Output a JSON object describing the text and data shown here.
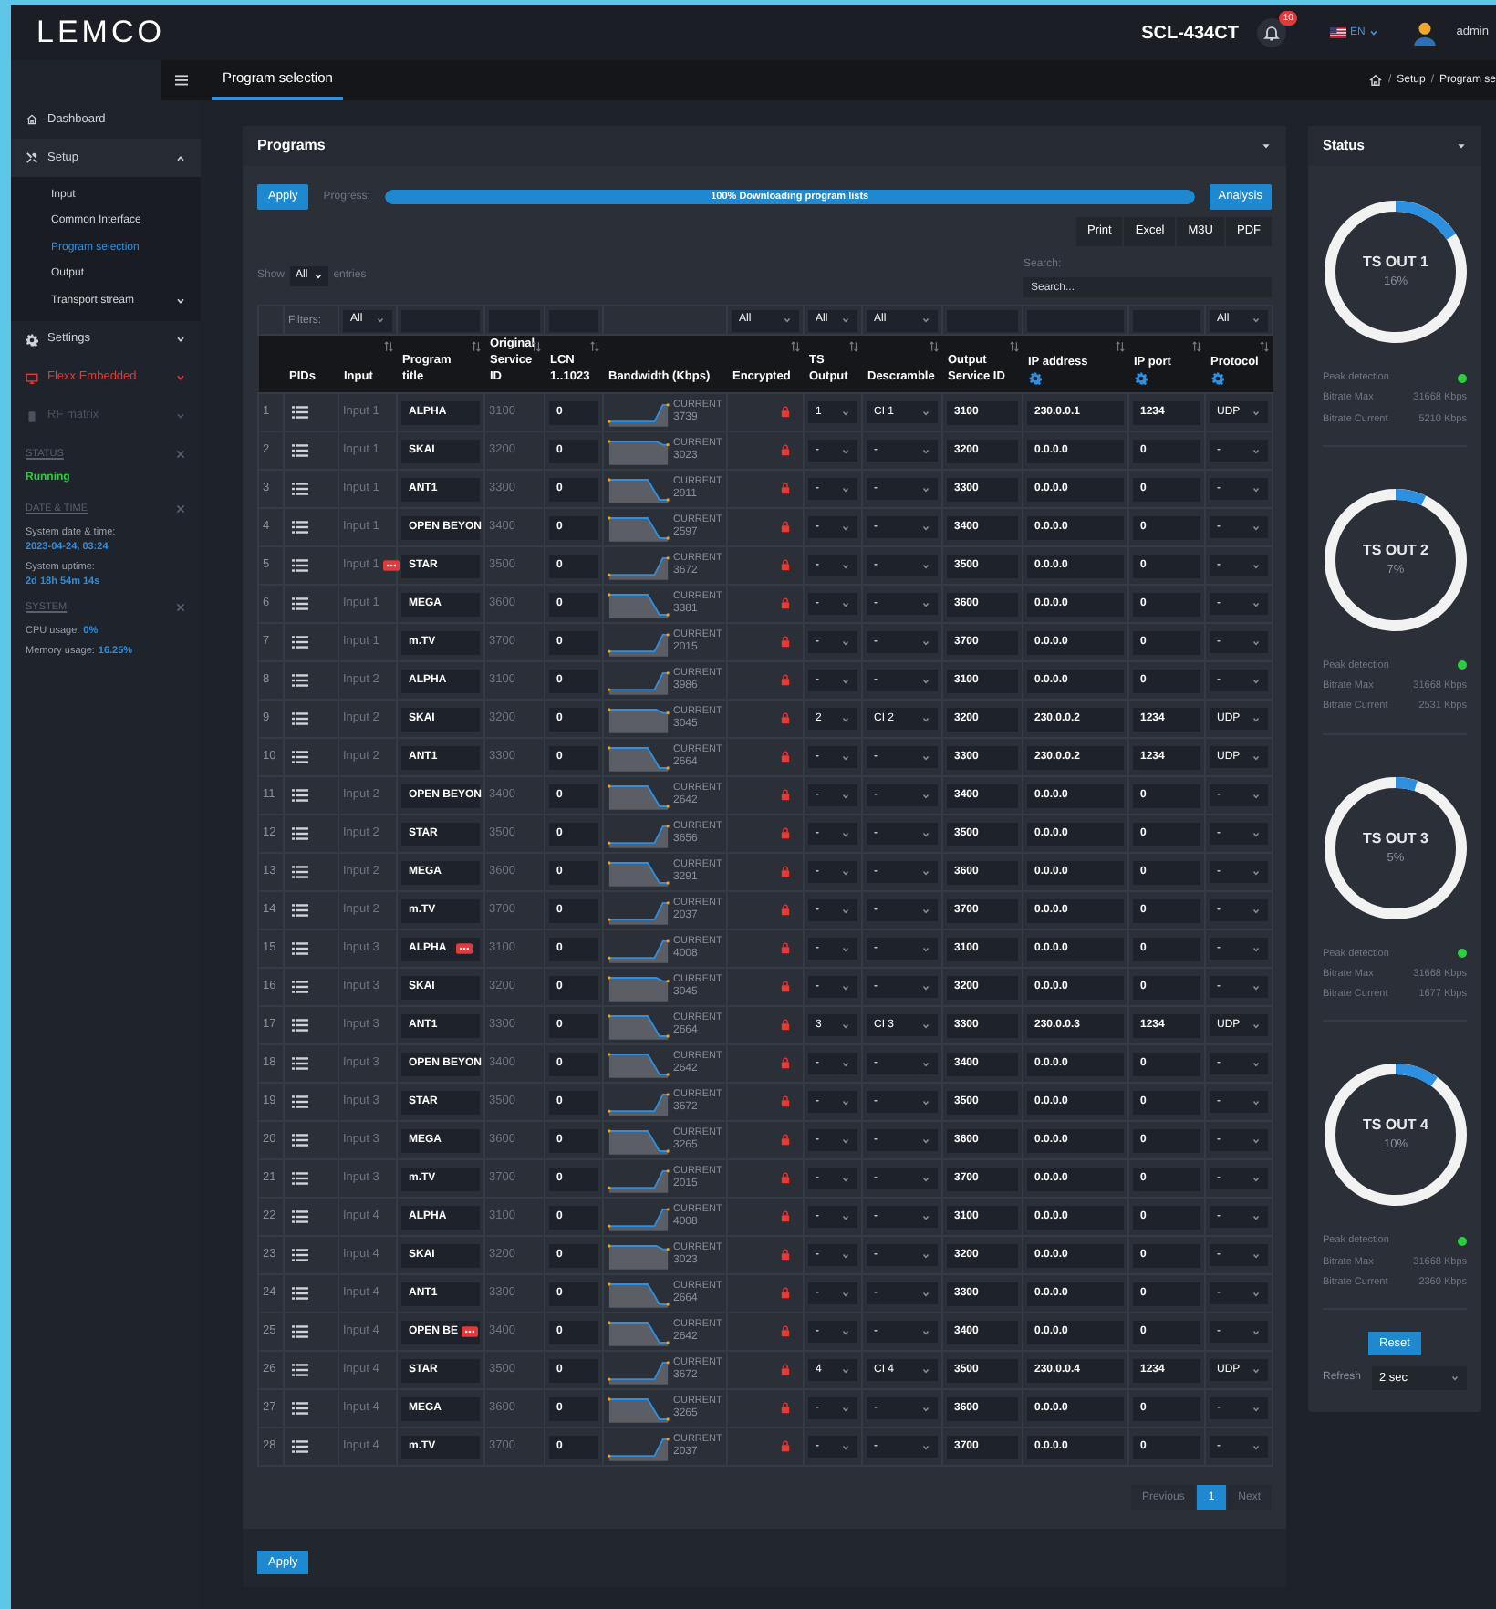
{
  "header": {
    "logo": "LEMCO",
    "device": "SCL-434CT",
    "notifications": "10",
    "language": "EN",
    "user": "admin"
  },
  "tab": "Program selection",
  "breadcrumb": [
    {
      "kind": "separator",
      "text": "/"
    },
    {
      "kind": "link",
      "text": "Setup"
    },
    {
      "kind": "separator",
      "text": "/"
    },
    {
      "kind": "link",
      "text": "Program se"
    }
  ],
  "sidebar": {
    "items": [
      {
        "label": "Dashboard",
        "disabled": false
      },
      {
        "label": "Setup",
        "disabled": false,
        "expanded": true,
        "children": [
          {
            "label": "Input",
            "selected": false
          },
          {
            "label": "Common Interface",
            "selected": false
          },
          {
            "label": "Program selection",
            "selected": true
          },
          {
            "label": "Output",
            "selected": false
          },
          {
            "label": "Transport stream",
            "selected": false,
            "expanded": false
          }
        ]
      },
      {
        "label": "Settings",
        "disabled": false,
        "expanded": false
      },
      {
        "label": "Flexx Embedded",
        "disabled": false,
        "expanded": false,
        "color": "#e53935"
      },
      {
        "label": "RF matrix",
        "disabled": true,
        "expanded": false
      }
    ],
    "sections": [
      {
        "title": "STATUS",
        "lines": [
          {
            "kind": "status",
            "value": "Running"
          }
        ]
      },
      {
        "title": "DATE & TIME",
        "lines": [
          {
            "kind": "stacked",
            "label": "System date & time:",
            "value": "2023-04-24, 03:24"
          },
          {
            "kind": "stacked",
            "label": "System uptime:",
            "value": "2d 18h 54m 14s"
          }
        ]
      },
      {
        "title": "SYSTEM",
        "lines": [
          {
            "kind": "inline",
            "label": "CPU usage:",
            "value": "0%"
          },
          {
            "kind": "inline",
            "label": "Memory usage:",
            "value": "16.25%"
          }
        ]
      }
    ]
  },
  "programs": {
    "title": "Programs",
    "apply": "Apply",
    "progress_label": "Progress:",
    "progress": {
      "level": 1,
      "text": "100% Downloading program lists"
    },
    "analysis": "Analysis",
    "exports": [
      "Print",
      "Excel",
      "M3U",
      "PDF"
    ],
    "show_label": "Show",
    "show_value": "All",
    "entries_label": "entries",
    "search_label": "Search:",
    "search_placeholder": "Search...",
    "table": {
      "filters": [
        {
          "kind": "blank"
        },
        {
          "kind": "label",
          "text": "Filters:"
        },
        {
          "kind": "select",
          "value": "All"
        },
        {
          "kind": "text"
        },
        {
          "kind": "text"
        },
        {
          "kind": "text"
        },
        {
          "kind": "blank"
        },
        {
          "kind": "select",
          "value": "All"
        },
        {
          "kind": "select",
          "value": "All"
        },
        {
          "kind": "select",
          "value": "All"
        },
        {
          "kind": "text"
        },
        {
          "kind": "text"
        },
        {
          "kind": "text"
        },
        {
          "kind": "select",
          "value": "All"
        }
      ],
      "columns": [
        {
          "sortable": false,
          "settings": false
        },
        {
          "label": "PIDs",
          "sortable": false,
          "settings": false
        },
        {
          "label": "Input",
          "sortable": true,
          "settings": false
        },
        {
          "label": "Program title",
          "sortable": true,
          "settings": false
        },
        {
          "label": "Original Service ID",
          "sortable": true,
          "settings": false
        },
        {
          "label": "LCN 1..1023",
          "sortable": true,
          "settings": false
        },
        {
          "label": "Bandwidth (Kbps)",
          "sortable": false,
          "settings": false
        },
        {
          "label": "Encrypted",
          "sortable": true,
          "settings": false
        },
        {
          "label": "TS Output",
          "sortable": true,
          "settings": false
        },
        {
          "label": "Descramble",
          "sortable": true,
          "settings": false
        },
        {
          "label": "Output Service ID",
          "sortable": true,
          "settings": false
        },
        {
          "label": "IP address",
          "sortable": true,
          "settings": true
        },
        {
          "label": "IP port",
          "sortable": true,
          "settings": true
        },
        {
          "label": "Protocol",
          "sortable": true,
          "settings": true
        }
      ],
      "rows": [
        {
          "no": "1",
          "input": "Input 1",
          "title": "ALPHA",
          "service_id": "3100",
          "lcn": "0",
          "sparkline": {
            "kind": "up"
          },
          "bw_label": "CURRENT",
          "bw": "3739",
          "encrypted": true,
          "ts_output": "1",
          "descramble": "CI 1",
          "output_sid": "3100",
          "ip": "230.0.0.1",
          "port": "1234",
          "protocol": "UDP"
        },
        {
          "no": "2",
          "input": "Input 1",
          "title": "SKAI",
          "service_id": "3200",
          "lcn": "0",
          "sparkline": {
            "kind": "flat"
          },
          "bw_label": "CURRENT",
          "bw": "3023",
          "encrypted": true,
          "ts_output": "-",
          "descramble": "-",
          "output_sid": "3200",
          "ip": "0.0.0.0",
          "port": "0",
          "protocol": "-"
        },
        {
          "no": "3",
          "input": "Input 1",
          "title": "ANT1",
          "service_id": "3300",
          "lcn": "0",
          "sparkline": {
            "kind": "down"
          },
          "bw_label": "CURRENT",
          "bw": "2911",
          "encrypted": true,
          "ts_output": "-",
          "descramble": "-",
          "output_sid": "3300",
          "ip": "0.0.0.0",
          "port": "0",
          "protocol": "-"
        },
        {
          "no": "4",
          "input": "Input 1",
          "title": "OPEN BEYON",
          "service_id": "3400",
          "lcn": "0",
          "sparkline": {
            "kind": "down"
          },
          "bw_label": "CURRENT",
          "bw": "2597",
          "encrypted": true,
          "ts_output": "-",
          "descramble": "-",
          "output_sid": "3400",
          "ip": "0.0.0.0",
          "port": "0",
          "protocol": "-"
        },
        {
          "no": "5",
          "input": "Input 1",
          "badge": {
            "kind": "input"
          },
          "title": "STAR",
          "service_id": "3500",
          "lcn": "0",
          "sparkline": {
            "kind": "up"
          },
          "bw_label": "CURRENT",
          "bw": "3672",
          "encrypted": true,
          "ts_output": "-",
          "descramble": "-",
          "output_sid": "3500",
          "ip": "0.0.0.0",
          "port": "0",
          "protocol": "-"
        },
        {
          "no": "6",
          "input": "Input 1",
          "title": "MEGA",
          "service_id": "3600",
          "lcn": "0",
          "sparkline": {
            "kind": "down"
          },
          "bw_label": "CURRENT",
          "bw": "3381",
          "encrypted": true,
          "ts_output": "-",
          "descramble": "-",
          "output_sid": "3600",
          "ip": "0.0.0.0",
          "port": "0",
          "protocol": "-"
        },
        {
          "no": "7",
          "input": "Input 1",
          "title": "m.TV",
          "service_id": "3700",
          "lcn": "0",
          "sparkline": {
            "kind": "up"
          },
          "bw_label": "CURRENT",
          "bw": "2015",
          "encrypted": true,
          "ts_output": "-",
          "descramble": "-",
          "output_sid": "3700",
          "ip": "0.0.0.0",
          "port": "0",
          "protocol": "-"
        },
        {
          "no": "8",
          "input": "Input 2",
          "title": "ALPHA",
          "service_id": "3100",
          "lcn": "0",
          "sparkline": {
            "kind": "up"
          },
          "bw_label": "CURRENT",
          "bw": "3986",
          "encrypted": true,
          "ts_output": "-",
          "descramble": "-",
          "output_sid": "3100",
          "ip": "0.0.0.0",
          "port": "0",
          "protocol": "-"
        },
        {
          "no": "9",
          "input": "Input 2",
          "title": "SKAI",
          "service_id": "3200",
          "lcn": "0",
          "sparkline": {
            "kind": "flat"
          },
          "bw_label": "CURRENT",
          "bw": "3045",
          "encrypted": true,
          "ts_output": "2",
          "descramble": "CI 2",
          "output_sid": "3200",
          "ip": "230.0.0.2",
          "port": "1234",
          "protocol": "UDP"
        },
        {
          "no": "10",
          "input": "Input 2",
          "title": "ANT1",
          "service_id": "3300",
          "lcn": "0",
          "sparkline": {
            "kind": "down"
          },
          "bw_label": "CURRENT",
          "bw": "2664",
          "encrypted": true,
          "ts_output": "-",
          "descramble": "-",
          "output_sid": "3300",
          "ip": "230.0.0.2",
          "port": "1234",
          "protocol": "UDP"
        },
        {
          "no": "11",
          "input": "Input 2",
          "title": "OPEN BEYON",
          "service_id": "3400",
          "lcn": "0",
          "sparkline": {
            "kind": "down"
          },
          "bw_label": "CURRENT",
          "bw": "2642",
          "encrypted": true,
          "ts_output": "-",
          "descramble": "-",
          "output_sid": "3400",
          "ip": "0.0.0.0",
          "port": "0",
          "protocol": "-"
        },
        {
          "no": "12",
          "input": "Input 2",
          "title": "STAR",
          "service_id": "3500",
          "lcn": "0",
          "sparkline": {
            "kind": "up"
          },
          "bw_label": "CURRENT",
          "bw": "3656",
          "encrypted": true,
          "ts_output": "-",
          "descramble": "-",
          "output_sid": "3500",
          "ip": "0.0.0.0",
          "port": "0",
          "protocol": "-"
        },
        {
          "no": "13",
          "input": "Input 2",
          "title": "MEGA",
          "service_id": "3600",
          "lcn": "0",
          "sparkline": {
            "kind": "down"
          },
          "bw_label": "CURRENT",
          "bw": "3291",
          "encrypted": true,
          "ts_output": "-",
          "descramble": "-",
          "output_sid": "3600",
          "ip": "0.0.0.0",
          "port": "0",
          "protocol": "-"
        },
        {
          "no": "14",
          "input": "Input 2",
          "title": "m.TV",
          "service_id": "3700",
          "lcn": "0",
          "sparkline": {
            "kind": "up"
          },
          "bw_label": "CURRENT",
          "bw": "2037",
          "encrypted": true,
          "ts_output": "-",
          "descramble": "-",
          "output_sid": "3700",
          "ip": "0.0.0.0",
          "port": "0",
          "protocol": "-"
        },
        {
          "no": "15",
          "input": "Input 3",
          "title": "ALPHA",
          "badge": {
            "kind": "title"
          },
          "service_id": "3100",
          "lcn": "0",
          "sparkline": {
            "kind": "up"
          },
          "bw_label": "CURRENT",
          "bw": "4008",
          "encrypted": true,
          "ts_output": "-",
          "descramble": "-",
          "output_sid": "3100",
          "ip": "0.0.0.0",
          "port": "0",
          "protocol": "-"
        },
        {
          "no": "16",
          "input": "Input 3",
          "title": "SKAI",
          "service_id": "3200",
          "lcn": "0",
          "sparkline": {
            "kind": "flat"
          },
          "bw_label": "CURRENT",
          "bw": "3045",
          "encrypted": true,
          "ts_output": "-",
          "descramble": "-",
          "output_sid": "3200",
          "ip": "0.0.0.0",
          "port": "0",
          "protocol": "-"
        },
        {
          "no": "17",
          "input": "Input 3",
          "title": "ANT1",
          "service_id": "3300",
          "lcn": "0",
          "sparkline": {
            "kind": "down"
          },
          "bw_label": "CURRENT",
          "bw": "2664",
          "encrypted": true,
          "ts_output": "3",
          "descramble": "CI 3",
          "output_sid": "3300",
          "ip": "230.0.0.3",
          "port": "1234",
          "protocol": "UDP"
        },
        {
          "no": "18",
          "input": "Input 3",
          "title": "OPEN BEYON",
          "service_id": "3400",
          "lcn": "0",
          "sparkline": {
            "kind": "down"
          },
          "bw_label": "CURRENT",
          "bw": "2642",
          "encrypted": true,
          "ts_output": "-",
          "descramble": "-",
          "output_sid": "3400",
          "ip": "0.0.0.0",
          "port": "0",
          "protocol": "-"
        },
        {
          "no": "19",
          "input": "Input 3",
          "title": "STAR",
          "service_id": "3500",
          "lcn": "0",
          "sparkline": {
            "kind": "up"
          },
          "bw_label": "CURRENT",
          "bw": "3672",
          "encrypted": true,
          "ts_output": "-",
          "descramble": "-",
          "output_sid": "3500",
          "ip": "0.0.0.0",
          "port": "0",
          "protocol": "-"
        },
        {
          "no": "20",
          "input": "Input 3",
          "title": "MEGA",
          "service_id": "3600",
          "lcn": "0",
          "sparkline": {
            "kind": "down"
          },
          "bw_label": "CURRENT",
          "bw": "3265",
          "encrypted": true,
          "ts_output": "-",
          "descramble": "-",
          "output_sid": "3600",
          "ip": "0.0.0.0",
          "port": "0",
          "protocol": "-"
        },
        {
          "no": "21",
          "input": "Input 3",
          "title": "m.TV",
          "service_id": "3700",
          "lcn": "0",
          "sparkline": {
            "kind": "up"
          },
          "bw_label": "CURRENT",
          "bw": "2015",
          "encrypted": true,
          "ts_output": "-",
          "descramble": "-",
          "output_sid": "3700",
          "ip": "0.0.0.0",
          "port": "0",
          "protocol": "-"
        },
        {
          "no": "22",
          "input": "Input 4",
          "title": "ALPHA",
          "service_id": "3100",
          "lcn": "0",
          "sparkline": {
            "kind": "up"
          },
          "bw_label": "CURRENT",
          "bw": "4008",
          "encrypted": true,
          "ts_output": "-",
          "descramble": "-",
          "output_sid": "3100",
          "ip": "0.0.0.0",
          "port": "0",
          "protocol": "-"
        },
        {
          "no": "23",
          "input": "Input 4",
          "title": "SKAI",
          "service_id": "3200",
          "lcn": "0",
          "sparkline": {
            "kind": "flat"
          },
          "bw_label": "CURRENT",
          "bw": "3023",
          "encrypted": true,
          "ts_output": "-",
          "descramble": "-",
          "output_sid": "3200",
          "ip": "0.0.0.0",
          "port": "0",
          "protocol": "-"
        },
        {
          "no": "24",
          "input": "Input 4",
          "title": "ANT1",
          "service_id": "3300",
          "lcn": "0",
          "sparkline": {
            "kind": "down"
          },
          "bw_label": "CURRENT",
          "bw": "2664",
          "encrypted": true,
          "ts_output": "-",
          "descramble": "-",
          "output_sid": "3300",
          "ip": "0.0.0.0",
          "port": "0",
          "protocol": "-"
        },
        {
          "no": "25",
          "input": "Input 4",
          "title": "OPEN BE",
          "badge": {
            "kind": "title"
          },
          "service_id": "3400",
          "lcn": "0",
          "sparkline": {
            "kind": "down"
          },
          "bw_label": "CURRENT",
          "bw": "2642",
          "encrypted": true,
          "ts_output": "-",
          "descramble": "-",
          "output_sid": "3400",
          "ip": "0.0.0.0",
          "port": "0",
          "protocol": "-"
        },
        {
          "no": "26",
          "input": "Input 4",
          "title": "STAR",
          "service_id": "3500",
          "lcn": "0",
          "sparkline": {
            "kind": "up"
          },
          "bw_label": "CURRENT",
          "bw": "3672",
          "encrypted": true,
          "ts_output": "4",
          "descramble": "CI 4",
          "output_sid": "3500",
          "ip": "230.0.0.4",
          "port": "1234",
          "protocol": "UDP"
        },
        {
          "no": "27",
          "input": "Input 4",
          "title": "MEGA",
          "service_id": "3600",
          "lcn": "0",
          "sparkline": {
            "kind": "down"
          },
          "bw_label": "CURRENT",
          "bw": "3265",
          "encrypted": true,
          "ts_output": "-",
          "descramble": "-",
          "output_sid": "3600",
          "ip": "0.0.0.0",
          "port": "0",
          "protocol": "-"
        },
        {
          "no": "28",
          "input": "Input 4",
          "title": "m.TV",
          "service_id": "3700",
          "lcn": "0",
          "sparkline": {
            "kind": "up"
          },
          "bw_label": "CURRENT",
          "bw": "2037",
          "encrypted": true,
          "ts_output": "-",
          "descramble": "-",
          "output_sid": "3700",
          "ip": "0.0.0.0",
          "port": "0",
          "protocol": "-"
        }
      ]
    },
    "pagination": [
      {
        "label": "Previous",
        "selected": false
      },
      {
        "label": "1",
        "selected": true
      },
      {
        "label": "Next",
        "selected": false
      }
    ],
    "footer_apply": "Apply"
  },
  "status": {
    "title": "Status",
    "outputs": [
      {
        "name": "TS OUT 1",
        "percent": "16%",
        "level": 0.16,
        "peak_label": "Peak detection",
        "color": "#2ecc40",
        "max_label": "Bitrate Max",
        "max": "31668 Kbps",
        "current_label": "Bitrate Current",
        "current": "5210 Kbps"
      },
      {
        "name": "TS OUT 2",
        "percent": "7%",
        "level": 0.07,
        "peak_label": "Peak detection",
        "color": "#2ecc40",
        "max_label": "Bitrate Max",
        "max": "31668 Kbps",
        "current_label": "Bitrate Current",
        "current": "2531 Kbps"
      },
      {
        "name": "TS OUT 3",
        "percent": "5%",
        "level": 0.05,
        "peak_label": "Peak detection",
        "color": "#2ecc40",
        "max_label": "Bitrate Max",
        "max": "31668 Kbps",
        "current_label": "Bitrate Current",
        "current": "1677 Kbps"
      },
      {
        "name": "TS OUT 4",
        "percent": "10%",
        "level": 0.1,
        "peak_label": "Peak detection",
        "color": "#2ecc40",
        "max_label": "Bitrate Max",
        "max": "31668 Kbps",
        "current_label": "Bitrate Current",
        "current": "2360 Kbps"
      }
    ],
    "reset": "Reset",
    "refresh_label": "Refresh",
    "refresh_value": "2 sec"
  }
}
